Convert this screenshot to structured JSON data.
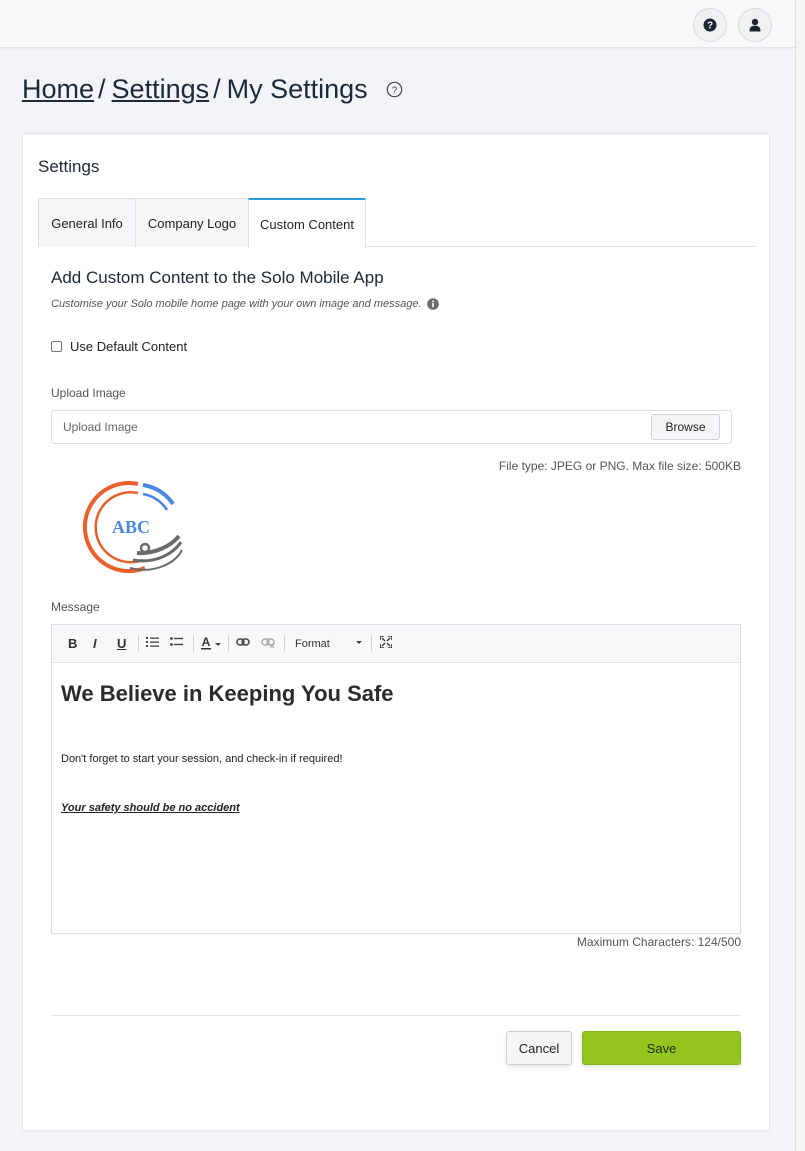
{
  "header": {
    "help_button": "help-icon",
    "profile_button": "user-icon"
  },
  "breadcrumb": {
    "home": "Home",
    "sep1": "/",
    "settings": "Settings",
    "sep2": "/",
    "current": "My Settings"
  },
  "card": {
    "title": "Settings",
    "tabs": [
      {
        "label": "General Info"
      },
      {
        "label": "Company Logo"
      },
      {
        "label": "Custom Content",
        "active": true
      }
    ]
  },
  "content": {
    "title": "Add Custom Content to the Solo Mobile App",
    "subtitle": "Customise your Solo mobile home page with your own image and message.",
    "default_checkbox_label": "Use Default Content",
    "default_checked": false,
    "upload_label": "Upload Image",
    "upload_placeholder": "Upload Image",
    "browse_label": "Browse",
    "file_hint": "File type: JPEG or PNG. Max file size: 500KB",
    "logo_text": "ABC",
    "message_label": "Message",
    "toolbar": {
      "bold": "B",
      "italic": "I",
      "underline": "U",
      "format": "Format"
    },
    "editor": {
      "heading": "We Believe in Keeping You Safe",
      "paragraph": "Don't forget to start your session, and check-in if required!",
      "tagline": "Your safety should be no accident"
    },
    "max_chars": "Maximum Characters: 124/500"
  },
  "actions": {
    "cancel": "Cancel",
    "save": "Save"
  },
  "colors": {
    "accent_tab": "#2f9bdc",
    "save_button": "#94c51f",
    "logo_orange": "#e8602c",
    "logo_blue": "#4a87e0",
    "logo_grey": "#6b6b6b"
  }
}
